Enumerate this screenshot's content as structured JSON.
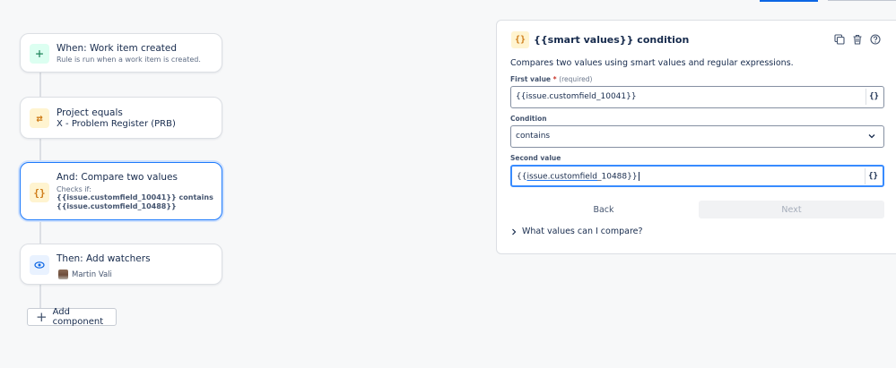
{
  "top_tabs": [
    {
      "name": "active-tab-indicator",
      "color": "#0c66e4"
    },
    {
      "name": "inactive-tab-indicator",
      "color": "#c1c7d0"
    }
  ],
  "flow": {
    "trigger": {
      "title": "When: Work item created",
      "subtitle": "Rule is run when a work item is created.",
      "icon": "plus-icon"
    },
    "project_condition": {
      "title": "Project equals",
      "value": "X - Problem Register (PRB)",
      "icon": "swap-arrows-icon"
    },
    "compare_condition": {
      "title": "And: Compare two values",
      "checks_label": "Checks if:",
      "code_line1": "{{issue.customfield_10041}} contains",
      "code_line2": "{{issue.customfield_10488}}",
      "icon": "curly-braces-icon"
    },
    "action": {
      "title": "Then: Add watchers",
      "watcher": "Martin Vali",
      "icon": "eye-icon"
    },
    "add_component_label": "Add component"
  },
  "panel": {
    "title": "{{smart values}} condition",
    "description": "Compares two values using smart values and regular expressions.",
    "first_value": {
      "label": "First value",
      "required_mark": "*",
      "hint": "(required)",
      "value": "{{issue.customfield_10041}}"
    },
    "condition": {
      "label": "Condition",
      "value": "contains"
    },
    "second_value": {
      "label": "Second value",
      "value_prefix": "{{",
      "value_link": "issue.customfield",
      "value_suffix": "_10488}}"
    },
    "smart_value_button": "{}",
    "back_label": "Back",
    "next_label": "Next",
    "help_toggle": "What values can I compare?"
  },
  "colors": {
    "accent": "#0c66e4",
    "focus_border": "#388bff",
    "condition_icon": "#cf7c18",
    "trigger_icon": "#1f845a"
  }
}
